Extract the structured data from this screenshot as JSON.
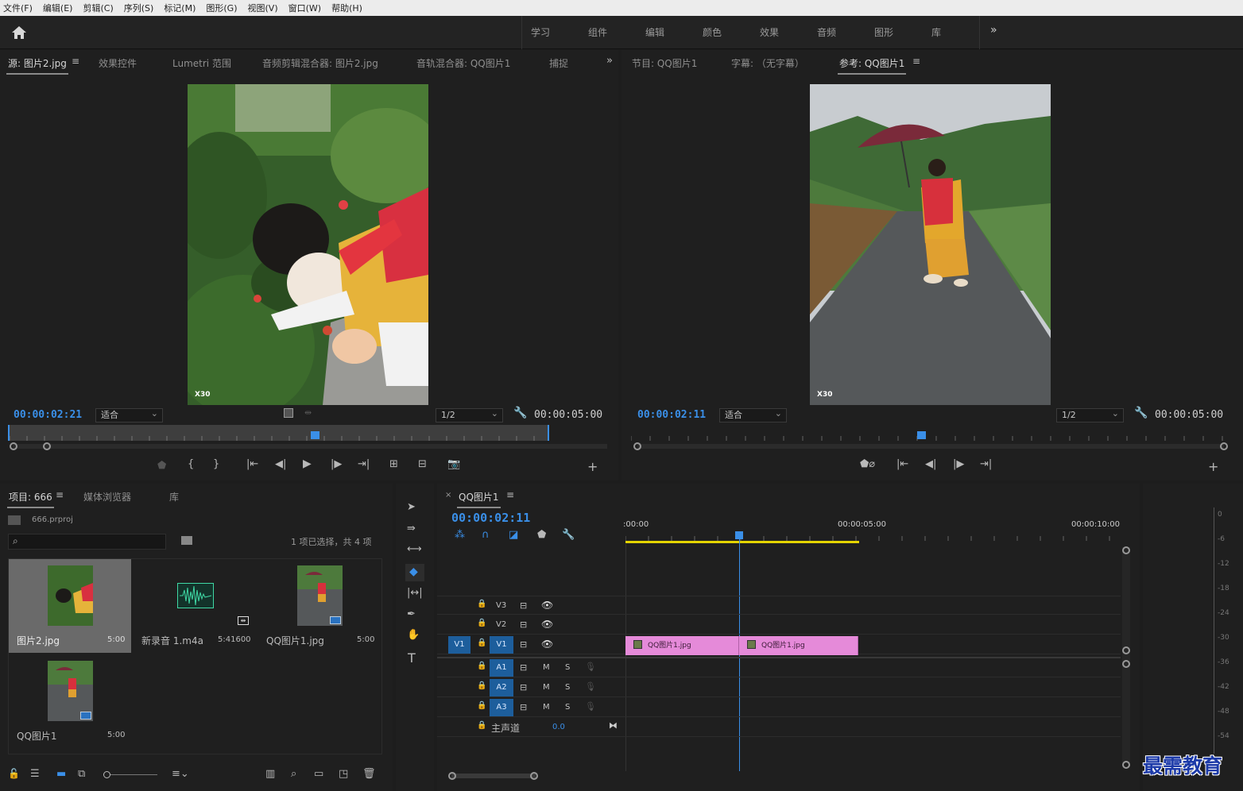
{
  "menu": [
    "文件(F)",
    "编辑(E)",
    "剪辑(C)",
    "序列(S)",
    "标记(M)",
    "图形(G)",
    "视图(V)",
    "窗口(W)",
    "帮助(H)"
  ],
  "workspaces": [
    "学习",
    "组件",
    "编辑",
    "颜色",
    "效果",
    "音频",
    "图形",
    "库"
  ],
  "source_panel": {
    "tabs": [
      "源: 图片2.jpg",
      "效果控件",
      "Lumetri 范围",
      "音频剪辑混合器: 图片2.jpg",
      "音轨混合器: QQ图片1",
      "捕捉"
    ],
    "timecode": "00:00:02:21",
    "fit": "适合",
    "resolution": "1/2",
    "duration": "00:00:05:00",
    "photo_watermark": "X30"
  },
  "program_panel": {
    "tabs": [
      "节目: QQ图片1",
      "字幕: （无字幕）",
      "参考: QQ图片1"
    ],
    "timecode": "00:00:02:11",
    "fit": "适合",
    "resolution": "1/2",
    "duration": "00:00:05:00",
    "photo_watermark": "X30"
  },
  "project_panel": {
    "tabs": [
      "项目: 666",
      "媒体浏览器",
      "库"
    ],
    "project_file": "666.prproj",
    "selection_info": "1 项已选择，共 4 项",
    "items": [
      {
        "name": "图片2.jpg",
        "duration": "5:00"
      },
      {
        "name": "新录音 1.m4a",
        "duration": "5:41600"
      },
      {
        "name": "QQ图片1.jpg",
        "duration": "5:00"
      },
      {
        "name": "QQ图片1",
        "duration": "5:00"
      }
    ]
  },
  "timeline": {
    "tab": "QQ图片1",
    "timecode": "00:00:02:11",
    "ruler": [
      ":00:00",
      "00:00:05:00",
      "00:00:10:00"
    ],
    "video_tracks": [
      "V3",
      "V2",
      "V1"
    ],
    "source_patch": "V1",
    "audio_tracks": [
      "A1",
      "A2",
      "A3"
    ],
    "mute": "M",
    "solo": "S",
    "master_label": "主声道",
    "master_value": "0.0",
    "clips": [
      "QQ图片1.jpg",
      "QQ图片1.jpg"
    ]
  },
  "audio_meter": [
    "0",
    "-6",
    "-12",
    "-18",
    "-24",
    "-30",
    "-36",
    "-42",
    "-48",
    "-54"
  ],
  "watermark": "最需教育",
  "colors": {
    "accent": "#3a8fe8",
    "clip": "#e58ad9",
    "work_area": "#e4d400"
  }
}
